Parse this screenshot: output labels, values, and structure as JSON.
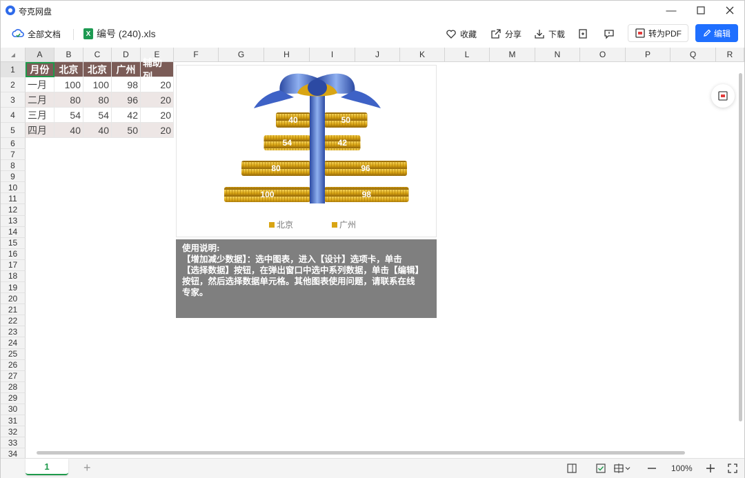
{
  "app": {
    "title": "夸克网盘"
  },
  "toolbar": {
    "all_docs": "全部文档",
    "file_name": "编号 (240).xls",
    "favorite": "收藏",
    "share": "分享",
    "download": "下载",
    "to_pdf": "转为PDF",
    "edit": "编辑"
  },
  "columns": [
    "A",
    "B",
    "C",
    "D",
    "E",
    "F",
    "G",
    "H",
    "I",
    "J",
    "K",
    "L",
    "M",
    "N",
    "O",
    "P",
    "Q",
    "R"
  ],
  "rows": [
    "1",
    "2",
    "3",
    "4",
    "5",
    "6",
    "7",
    "8",
    "9",
    "10",
    "11",
    "12",
    "13",
    "14",
    "15",
    "16",
    "17",
    "18",
    "19",
    "20",
    "21",
    "22",
    "23",
    "24",
    "25",
    "26",
    "27",
    "28",
    "29",
    "30",
    "31",
    "32",
    "33",
    "34"
  ],
  "table": {
    "headers": [
      "月份",
      "北京",
      "北京",
      "广州",
      "辅助列"
    ],
    "rows": [
      [
        "一月",
        "100",
        "100",
        "98",
        "20"
      ],
      [
        "二月",
        "80",
        "80",
        "96",
        "20"
      ],
      [
        "三月",
        "54",
        "54",
        "42",
        "20"
      ],
      [
        "四月",
        "40",
        "40",
        "50",
        "20"
      ]
    ]
  },
  "chart_data": {
    "type": "bar",
    "categories": [
      "一月",
      "二月",
      "三月",
      "四月"
    ],
    "series": [
      {
        "name": "北京",
        "values": [
          100,
          80,
          54,
          40
        ]
      },
      {
        "name": "广州",
        "values": [
          98,
          96,
          42,
          50
        ]
      }
    ],
    "legend": "bottom",
    "colors": {
      "coin": "#d9a514",
      "ribbon": "#3e62c6"
    }
  },
  "note": {
    "title": "使用说明:",
    "lines": [
      "【增加减少数据】：选中图表，进入【设计】选项卡，单击",
      "【选择数据】按钮，在弹出窗口中选中系列数据，单击【编辑】",
      "按钮，然后选择数据单元格。其他图表使用问题，请联系在线",
      "专家。"
    ]
  },
  "statusbar": {
    "sheet_tab": "1",
    "add": "+",
    "zoom": "100%"
  },
  "colors": {
    "accent": "#1f6fff",
    "header_fill": "#7b5c57",
    "alt_row": "#ede6e5",
    "selection": "#1e9a4b"
  }
}
